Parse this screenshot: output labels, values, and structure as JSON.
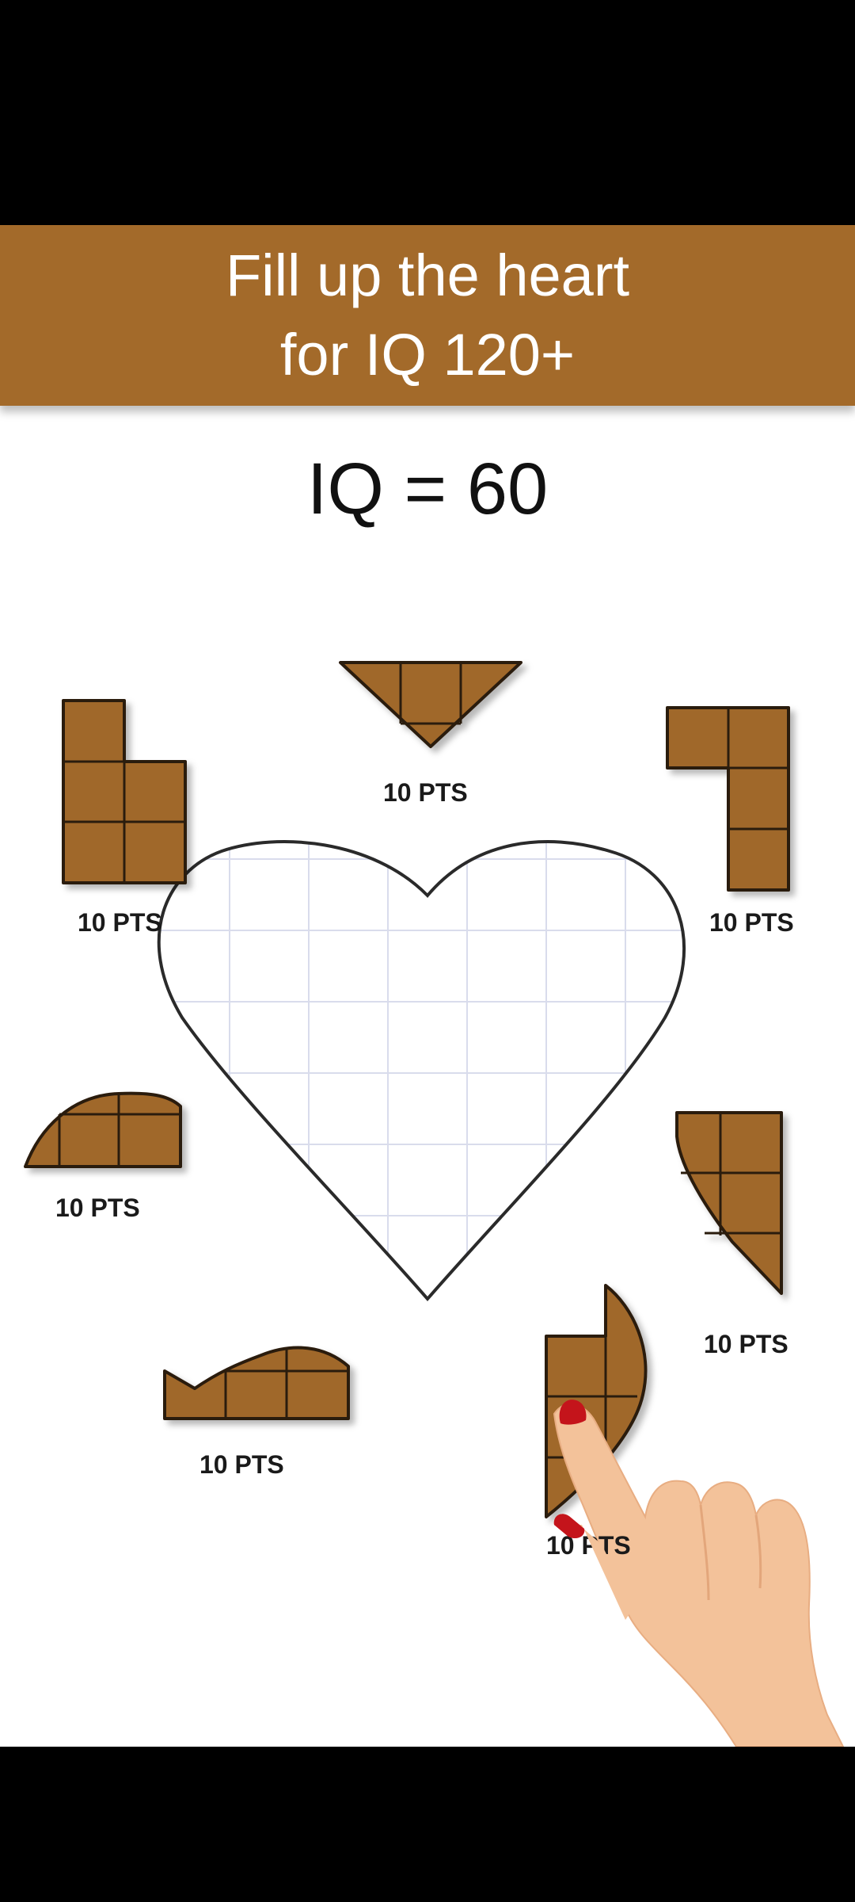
{
  "banner": {
    "line1": "Fill up the heart",
    "line2": "for IQ 120+"
  },
  "score": {
    "label": "IQ = 60"
  },
  "pieces": [
    {
      "id": "piece-top-triangle",
      "points": "10 PTS"
    },
    {
      "id": "piece-l-step",
      "points": "10 PTS"
    },
    {
      "id": "piece-j-shape",
      "points": "10 PTS"
    },
    {
      "id": "piece-dome",
      "points": "10 PTS"
    },
    {
      "id": "piece-curved-wedge",
      "points": "10 PTS"
    },
    {
      "id": "piece-wave",
      "points": "10 PTS"
    },
    {
      "id": "piece-crescent",
      "points": "10 PTS"
    }
  ],
  "colors": {
    "banner": "#a36a2a",
    "piece_fill": "#a0682c",
    "piece_stroke": "#2b1a0c",
    "grid": "#d9dcec",
    "skin": "#f3c29a",
    "nail": "#c4141b"
  },
  "icons": [
    "hand-pointer-icon"
  ]
}
